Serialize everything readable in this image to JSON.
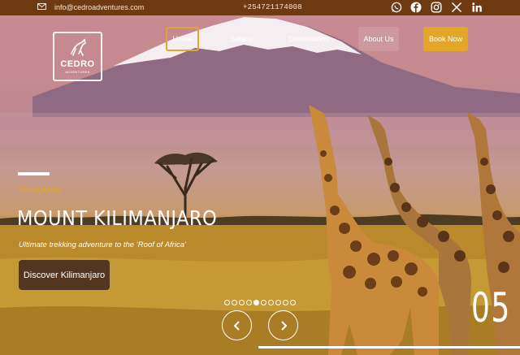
{
  "topbar": {
    "email": "info@cedroadventures.com",
    "phone": "+254721174008",
    "social_icons": [
      "whatsapp-icon",
      "facebook-icon",
      "instagram-icon",
      "x-icon",
      "linkedin-icon"
    ]
  },
  "logo": {
    "name": "CEDRO",
    "tagline": "ADVENTURES"
  },
  "nav": {
    "home": "Home",
    "safaris": "Safaris",
    "destinations": "Destinations",
    "about": "About Us",
    "book": "Book Now"
  },
  "hero": {
    "kicker": "TANZANIA",
    "title": "MOUNT KILIMANJARO",
    "tagline": "Ultimate trekking adventure to the ‘Roof of Africa’",
    "cta": "Discover Kilimanjaro",
    "slide_number": "05",
    "slide_count": 10,
    "active_slide": 5
  },
  "colors": {
    "topbar": "#6e3a14",
    "accent": "#e3a627",
    "cta_bg": "#53361f"
  }
}
